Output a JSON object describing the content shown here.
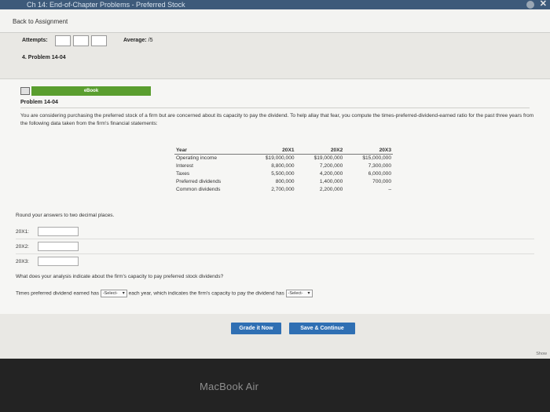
{
  "window": {
    "tab_title": "Ch 14: End-of-Chapter Problems - Preferred Stock",
    "close_glyph": "✕"
  },
  "nav": {
    "back_label": "Back to Assignment"
  },
  "header": {
    "attempts_label": "Attempts:",
    "average_label": "Average:",
    "average_value": "/5",
    "problem_number": "4. Problem 14-04"
  },
  "problem": {
    "ebook_label": "eBook",
    "title": "Problem 14-04",
    "description": "You are considering purchasing the preferred stock of a firm but are concerned about its capacity to pay the dividend. To help allay that fear, you compute the times-preferred-dividend-earned ratio for the past three years from the following data taken from the firm's financial statements:"
  },
  "financials": {
    "headers": [
      "Year",
      "20X1",
      "20X2",
      "20X3"
    ],
    "rows": [
      {
        "label": "Operating income",
        "v1": "$19,000,000",
        "v2": "$19,000,000",
        "v3": "$15,000,000"
      },
      {
        "label": "Interest",
        "v1": "8,800,000",
        "v2": "7,200,000",
        "v3": "7,300,000"
      },
      {
        "label": "Taxes",
        "v1": "5,500,000",
        "v2": "4,200,000",
        "v3": "6,000,000"
      },
      {
        "label": "Preferred dividends",
        "v1": "800,000",
        "v2": "1,400,000",
        "v3": "700,000"
      },
      {
        "label": "Common dividends",
        "v1": "2,700,000",
        "v2": "2,200,000",
        "v3": "–"
      }
    ]
  },
  "answers": {
    "round_note": "Round your answers to two decimal places.",
    "items": [
      {
        "label": "20X1:",
        "value": ""
      },
      {
        "label": "20X2:",
        "value": ""
      },
      {
        "label": "20X3:",
        "value": ""
      }
    ]
  },
  "analysis": {
    "question": "What does your analysis indicate about the firm's capacity to pay preferred stock dividends?",
    "sentence_start": "Times preferred dividend earned has",
    "select1_value": "-Select-",
    "sentence_mid": "each year, which indicates the firm's capacity to pay the dividend has",
    "select2_value": "-Select-"
  },
  "actions": {
    "grade_label": "Grade it Now",
    "save_label": "Save & Continue",
    "show_label": "Show"
  },
  "device": {
    "label": "MacBook Air"
  }
}
